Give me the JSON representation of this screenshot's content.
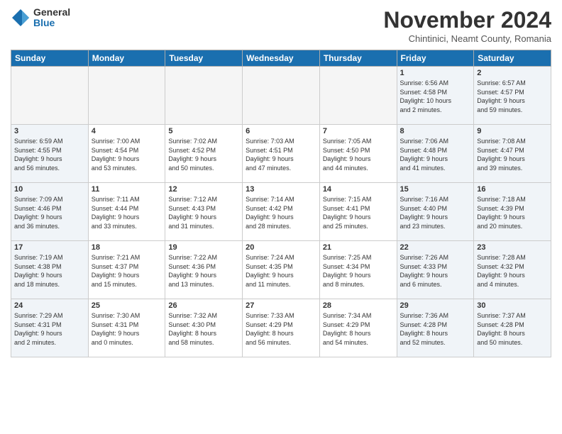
{
  "logo": {
    "general": "General",
    "blue": "Blue"
  },
  "title": "November 2024",
  "location": "Chintinici, Neamt County, Romania",
  "days_header": [
    "Sunday",
    "Monday",
    "Tuesday",
    "Wednesday",
    "Thursday",
    "Friday",
    "Saturday"
  ],
  "weeks": [
    [
      {
        "day": "",
        "info": "",
        "type": "empty"
      },
      {
        "day": "",
        "info": "",
        "type": "empty"
      },
      {
        "day": "",
        "info": "",
        "type": "empty"
      },
      {
        "day": "",
        "info": "",
        "type": "empty"
      },
      {
        "day": "",
        "info": "",
        "type": "empty"
      },
      {
        "day": "1",
        "info": "Sunrise: 6:56 AM\nSunset: 4:58 PM\nDaylight: 10 hours\nand 2 minutes.",
        "type": "weekend"
      },
      {
        "day": "2",
        "info": "Sunrise: 6:57 AM\nSunset: 4:57 PM\nDaylight: 9 hours\nand 59 minutes.",
        "type": "weekend"
      }
    ],
    [
      {
        "day": "3",
        "info": "Sunrise: 6:59 AM\nSunset: 4:55 PM\nDaylight: 9 hours\nand 56 minutes.",
        "type": "weekend"
      },
      {
        "day": "4",
        "info": "Sunrise: 7:00 AM\nSunset: 4:54 PM\nDaylight: 9 hours\nand 53 minutes.",
        "type": "normal"
      },
      {
        "day": "5",
        "info": "Sunrise: 7:02 AM\nSunset: 4:52 PM\nDaylight: 9 hours\nand 50 minutes.",
        "type": "normal"
      },
      {
        "day": "6",
        "info": "Sunrise: 7:03 AM\nSunset: 4:51 PM\nDaylight: 9 hours\nand 47 minutes.",
        "type": "normal"
      },
      {
        "day": "7",
        "info": "Sunrise: 7:05 AM\nSunset: 4:50 PM\nDaylight: 9 hours\nand 44 minutes.",
        "type": "normal"
      },
      {
        "day": "8",
        "info": "Sunrise: 7:06 AM\nSunset: 4:48 PM\nDaylight: 9 hours\nand 41 minutes.",
        "type": "weekend"
      },
      {
        "day": "9",
        "info": "Sunrise: 7:08 AM\nSunset: 4:47 PM\nDaylight: 9 hours\nand 39 minutes.",
        "type": "weekend"
      }
    ],
    [
      {
        "day": "10",
        "info": "Sunrise: 7:09 AM\nSunset: 4:46 PM\nDaylight: 9 hours\nand 36 minutes.",
        "type": "weekend"
      },
      {
        "day": "11",
        "info": "Sunrise: 7:11 AM\nSunset: 4:44 PM\nDaylight: 9 hours\nand 33 minutes.",
        "type": "normal"
      },
      {
        "day": "12",
        "info": "Sunrise: 7:12 AM\nSunset: 4:43 PM\nDaylight: 9 hours\nand 31 minutes.",
        "type": "normal"
      },
      {
        "day": "13",
        "info": "Sunrise: 7:14 AM\nSunset: 4:42 PM\nDaylight: 9 hours\nand 28 minutes.",
        "type": "normal"
      },
      {
        "day": "14",
        "info": "Sunrise: 7:15 AM\nSunset: 4:41 PM\nDaylight: 9 hours\nand 25 minutes.",
        "type": "normal"
      },
      {
        "day": "15",
        "info": "Sunrise: 7:16 AM\nSunset: 4:40 PM\nDaylight: 9 hours\nand 23 minutes.",
        "type": "weekend"
      },
      {
        "day": "16",
        "info": "Sunrise: 7:18 AM\nSunset: 4:39 PM\nDaylight: 9 hours\nand 20 minutes.",
        "type": "weekend"
      }
    ],
    [
      {
        "day": "17",
        "info": "Sunrise: 7:19 AM\nSunset: 4:38 PM\nDaylight: 9 hours\nand 18 minutes.",
        "type": "weekend"
      },
      {
        "day": "18",
        "info": "Sunrise: 7:21 AM\nSunset: 4:37 PM\nDaylight: 9 hours\nand 15 minutes.",
        "type": "normal"
      },
      {
        "day": "19",
        "info": "Sunrise: 7:22 AM\nSunset: 4:36 PM\nDaylight: 9 hours\nand 13 minutes.",
        "type": "normal"
      },
      {
        "day": "20",
        "info": "Sunrise: 7:24 AM\nSunset: 4:35 PM\nDaylight: 9 hours\nand 11 minutes.",
        "type": "normal"
      },
      {
        "day": "21",
        "info": "Sunrise: 7:25 AM\nSunset: 4:34 PM\nDaylight: 9 hours\nand 8 minutes.",
        "type": "normal"
      },
      {
        "day": "22",
        "info": "Sunrise: 7:26 AM\nSunset: 4:33 PM\nDaylight: 9 hours\nand 6 minutes.",
        "type": "weekend"
      },
      {
        "day": "23",
        "info": "Sunrise: 7:28 AM\nSunset: 4:32 PM\nDaylight: 9 hours\nand 4 minutes.",
        "type": "weekend"
      }
    ],
    [
      {
        "day": "24",
        "info": "Sunrise: 7:29 AM\nSunset: 4:31 PM\nDaylight: 9 hours\nand 2 minutes.",
        "type": "weekend"
      },
      {
        "day": "25",
        "info": "Sunrise: 7:30 AM\nSunset: 4:31 PM\nDaylight: 9 hours\nand 0 minutes.",
        "type": "normal"
      },
      {
        "day": "26",
        "info": "Sunrise: 7:32 AM\nSunset: 4:30 PM\nDaylight: 8 hours\nand 58 minutes.",
        "type": "normal"
      },
      {
        "day": "27",
        "info": "Sunrise: 7:33 AM\nSunset: 4:29 PM\nDaylight: 8 hours\nand 56 minutes.",
        "type": "normal"
      },
      {
        "day": "28",
        "info": "Sunrise: 7:34 AM\nSunset: 4:29 PM\nDaylight: 8 hours\nand 54 minutes.",
        "type": "normal"
      },
      {
        "day": "29",
        "info": "Sunrise: 7:36 AM\nSunset: 4:28 PM\nDaylight: 8 hours\nand 52 minutes.",
        "type": "weekend"
      },
      {
        "day": "30",
        "info": "Sunrise: 7:37 AM\nSunset: 4:28 PM\nDaylight: 8 hours\nand 50 minutes.",
        "type": "weekend"
      }
    ]
  ]
}
